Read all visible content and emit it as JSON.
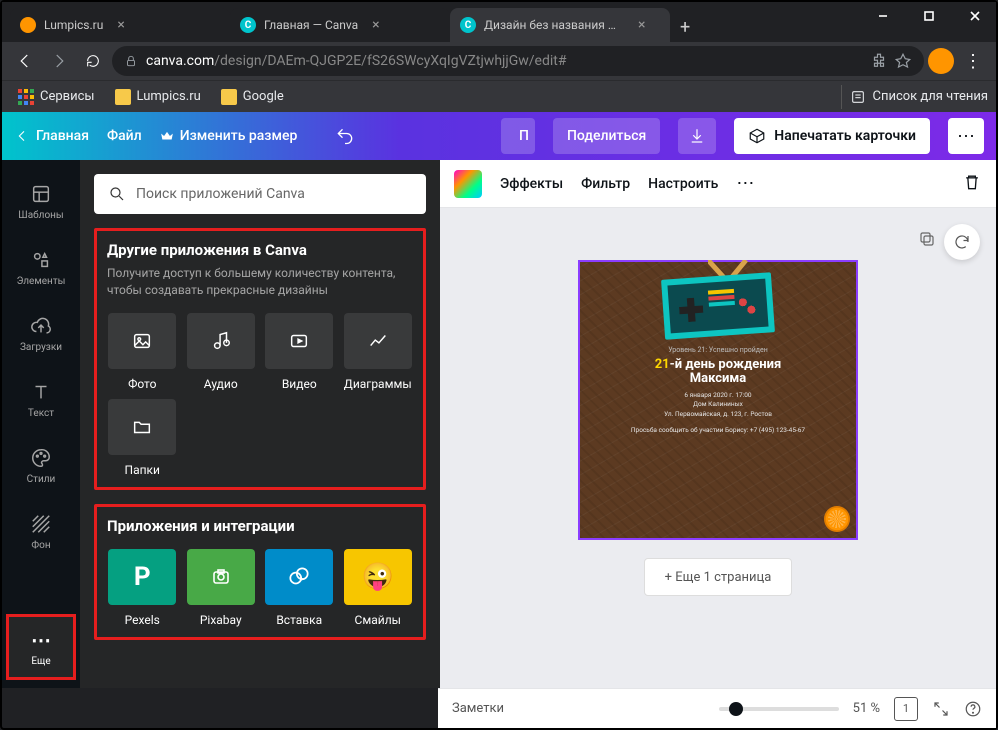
{
  "window": {
    "minimize": "–",
    "maximize": "□",
    "close": "✕"
  },
  "tabs": [
    {
      "title": "Lumpics.ru",
      "favicon_bg": "#ff9500"
    },
    {
      "title": "Главная — Canva",
      "favicon_bg": "#00c4cc",
      "favicon_text": "C"
    },
    {
      "title": "Дизайн без названия — Пригл",
      "favicon_bg": "#00c4cc",
      "favicon_text": "C",
      "active": true
    }
  ],
  "url": {
    "domain": "canva.com",
    "path": "/design/DAEm-QJGP2E/fS26SWcyXqIgVZtjwhjjGw/edit#"
  },
  "bookmarks": {
    "services": "Сервисы",
    "items": [
      "Lumpics.ru",
      "Google"
    ],
    "reading": "Список для чтения"
  },
  "canva_top": {
    "home": "Главная",
    "file": "Файл",
    "resize": "Изменить размер",
    "paywall": "П",
    "share": "Поделиться",
    "print": "Напечатать карточки"
  },
  "sidenav": {
    "templates": "Шаблоны",
    "elements": "Элементы",
    "uploads": "Загрузки",
    "text": "Текст",
    "styles": "Стили",
    "background": "Фон",
    "more": "Еще"
  },
  "panel": {
    "search_placeholder": "Поиск приложений Canva",
    "section1": {
      "title": "Другие приложения в Canva",
      "sub": "Получите доступ к большему количеству контента, чтобы создавать прекрасные дизайны",
      "items": [
        "Фото",
        "Аудио",
        "Видео",
        "Диаграммы",
        "Папки"
      ]
    },
    "section2": {
      "title": "Приложения и интеграции",
      "items": [
        "Pexels",
        "Pixabay",
        "Вставка",
        "Смайлы"
      ]
    }
  },
  "canvas_toolbar": {
    "effects": "Эффекты",
    "filter": "Фильтр",
    "adjust": "Настроить"
  },
  "design": {
    "level": "Уровень 21: Успешно пройден",
    "title_num": "21",
    "title_rest": "-й день рождения",
    "title_name": "Максима",
    "date": "6 января 2020 г. 17:00",
    "place": "Дом Калининых",
    "address": "Ул. Первомайская, д. 123, г. Ростов",
    "rsvp": "Просьба сообщить об участии Борису: +7 (495) 123-45-67"
  },
  "addpage": "+ Еще 1 страница",
  "bottom": {
    "notes": "Заметки",
    "zoom": "51 %",
    "pages": "1"
  }
}
